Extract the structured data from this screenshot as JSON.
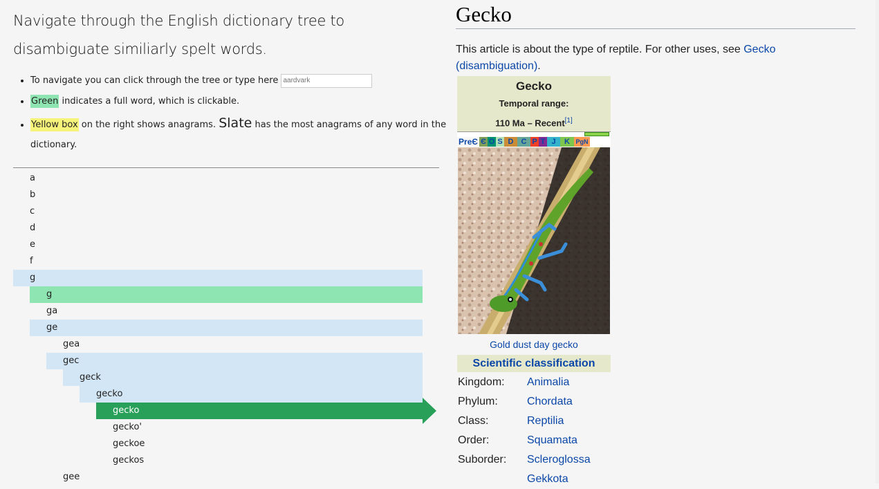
{
  "intro": {
    "title": "Navigate through the English dictionary tree to disambiguate similiarly spelt words.",
    "tip1": "To navigate you can click through the tree or type here",
    "tip1_placeholder": "aardvark",
    "tip2_highlight": "Green",
    "tip2_rest": "indicates a full word, which is clickable.",
    "tip3_highlight": "Yellow box",
    "tip3_mid": "on the right shows anagrams.",
    "tip3_word": "Slate",
    "tip3_rest": "has the most anagrams of any word in the dictionary."
  },
  "tree": {
    "rows": [
      {
        "label": "a",
        "state": "plain",
        "depth": 0
      },
      {
        "label": "b",
        "state": "plain",
        "depth": 0
      },
      {
        "label": "c",
        "state": "plain",
        "depth": 0
      },
      {
        "label": "d",
        "state": "plain",
        "depth": 0
      },
      {
        "label": "e",
        "state": "plain",
        "depth": 0
      },
      {
        "label": "f",
        "state": "plain",
        "depth": 0
      },
      {
        "label": "g",
        "state": "path",
        "depth": 0
      },
      {
        "label": "g",
        "state": "word",
        "depth": 1
      },
      {
        "label": "ga",
        "state": "plain",
        "depth": 1
      },
      {
        "label": "ge",
        "state": "path",
        "depth": 1
      },
      {
        "label": "gea",
        "state": "plain",
        "depth": 2
      },
      {
        "label": "gec",
        "state": "path",
        "depth": 2
      },
      {
        "label": "geck",
        "state": "path",
        "depth": 3
      },
      {
        "label": "gecko",
        "state": "path",
        "depth": 4
      },
      {
        "label": "gecko",
        "state": "current",
        "depth": 5
      },
      {
        "label": "gecko'",
        "state": "plain",
        "depth": 5
      },
      {
        "label": "geckoe",
        "state": "plain",
        "depth": 5
      },
      {
        "label": "geckos",
        "state": "plain",
        "depth": 5
      },
      {
        "label": "gee",
        "state": "plain",
        "depth": 2
      }
    ]
  },
  "article": {
    "title": "Gecko",
    "hatnote_prefix": "This article is about the type of reptile. For other uses, see",
    "hatnote_link": "Gecko (disambiguation)",
    "hatnote_suffix": "."
  },
  "infobox": {
    "name": "Gecko",
    "temporal_label": "Temporal range:",
    "temporal_value": "110 Ma – Recent",
    "temporal_ref": "[1]",
    "timeline": [
      "PreЄ",
      "Є",
      "O",
      "S",
      "D",
      "C",
      "P",
      "T",
      "J",
      "K",
      "PgN"
    ],
    "timeline_colors": [
      "#f7f7f7",
      "#7fa056",
      "#009270",
      "#b3e1b6",
      "#cb8c37",
      "#67a599",
      "#f04028",
      "#812b92",
      "#34b2c9",
      "#7fc64e",
      "#fd9a52"
    ],
    "caption": "Gold dust day gecko",
    "sci_heading": "Scientific classification",
    "taxonomy": [
      {
        "rank": "Kingdom:",
        "value": "Animalia"
      },
      {
        "rank": "Phylum:",
        "value": "Chordata"
      },
      {
        "rank": "Class:",
        "value": "Reptilia"
      },
      {
        "rank": "Order:",
        "value": "Squamata"
      },
      {
        "rank": "Suborder:",
        "value": "Scleroglossa"
      },
      {
        "rank": "",
        "value": "Gekkota"
      }
    ]
  }
}
